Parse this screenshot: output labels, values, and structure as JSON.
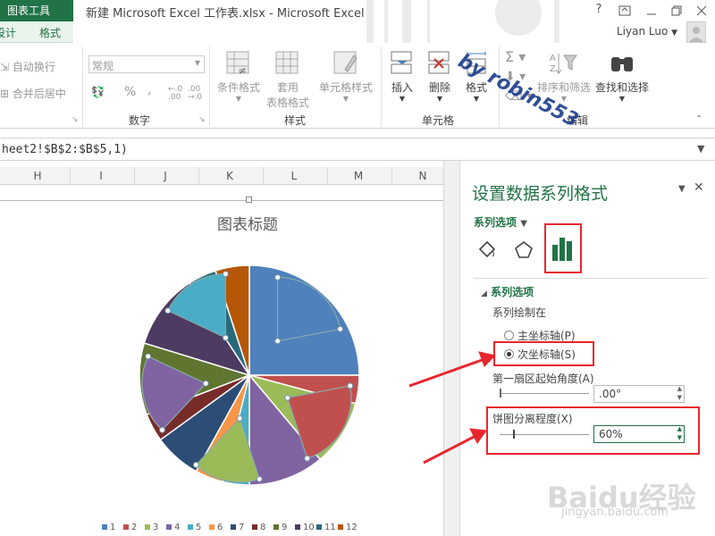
{
  "titlebar": {
    "context_tool": "图表工具",
    "context_tabs": [
      "设计",
      "格式"
    ],
    "document_title": "新建 Microsoft Excel 工作表.xlsx - Microsoft Excel",
    "help": "?",
    "user": "Liyan Luo"
  },
  "ribbon": {
    "alignment": {
      "wrap_text": "自动换行",
      "merge_center": "合并后居中"
    },
    "number": {
      "format_value": "常规",
      "percent": "%",
      "comma": ",",
      "group_label": "数字"
    },
    "styles": {
      "conditional": "条件格式",
      "table_line1": "套用",
      "table_line2": "表格格式",
      "cell_styles": "单元格样式",
      "group_label": "样式"
    },
    "cells": {
      "insert": "插入",
      "delete": "删除",
      "format": "格式",
      "group_label": "单元格"
    },
    "editing": {
      "sort_filter": "排序和筛选",
      "find_select": "查找和选择",
      "group_label": "编辑"
    }
  },
  "formula_bar": {
    "text": "heet2!$B$2:$B$5,1)"
  },
  "sheet": {
    "columns": [
      "H",
      "I",
      "J",
      "K",
      "L",
      "M",
      "N"
    ]
  },
  "chart_data": {
    "type": "pie",
    "title": "图表标题",
    "categories": [
      "1",
      "2",
      "3",
      "4",
      "5",
      "6",
      "7",
      "8",
      "9",
      "10",
      "11",
      "12"
    ],
    "primary_axis_values": [
      90,
      15,
      35,
      40,
      14,
      15,
      25,
      15,
      38,
      40,
      15,
      18
    ],
    "secondary_axis_values": [
      22,
      23,
      17,
      20,
      18
    ],
    "colors": [
      "#4f81bd",
      "#c0504d",
      "#9bbb59",
      "#8064a2",
      "#4bacc6",
      "#f79646",
      "#2c4d75",
      "#772c2a",
      "#5f7530",
      "#4d3b62",
      "#276a7c",
      "#b65708"
    ],
    "pie_explosion": "60%",
    "legend_position": "bottom"
  },
  "pane": {
    "title": "设置数据系列格式",
    "menu": "系列选项",
    "section": "系列选项",
    "plot_on_label": "系列绘制在",
    "primary_axis": "主坐标轴(P)",
    "secondary_axis": "次坐标轴(S)",
    "first_slice_angle_label": "第一扇区起始角度(A)",
    "first_slice_angle_value": ".00°",
    "pie_explosion_label": "饼图分离程度(X)",
    "pie_explosion_value": "60%"
  },
  "watermarks": {
    "author": "by robin553",
    "site_logo": "Baidu经验",
    "site_url": "jingyan.baidu.com"
  }
}
